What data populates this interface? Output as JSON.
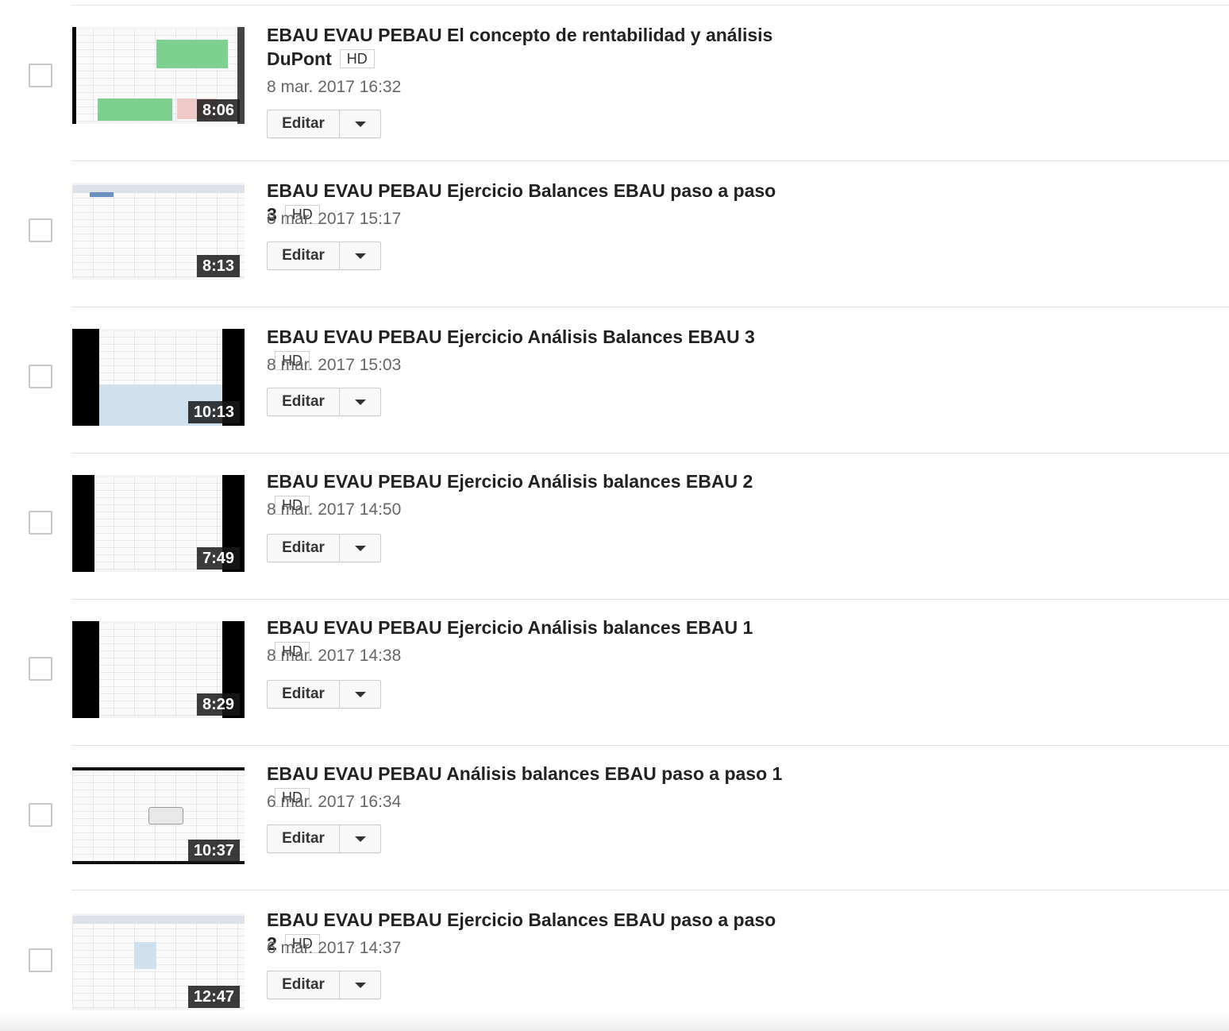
{
  "video_list": {
    "edit_label": "Editar",
    "hd_label": "HD",
    "videos": [
      {
        "title_line1": "EBAU EVAU PEBAU El concepto de rentabilidad y análisis",
        "title_line2": "DuPont",
        "date": "8 mar. 2017 16:32",
        "duration": "8:06"
      },
      {
        "title_line1": "EBAU EVAU PEBAU Ejercicio Balances EBAU paso a paso 3",
        "title_line2": "",
        "date": "8 mar. 2017 15:17",
        "duration": "8:13"
      },
      {
        "title_line1": "EBAU EVAU PEBAU Ejercicio Análisis Balances EBAU 3",
        "title_line2": "",
        "date": "8 mar. 2017 15:03",
        "duration": "10:13"
      },
      {
        "title_line1": "EBAU EVAU PEBAU Ejercicio Análisis balances EBAU 2",
        "title_line2": "",
        "date": "8 mar. 2017 14:50",
        "duration": "7:49"
      },
      {
        "title_line1": "EBAU EVAU PEBAU Ejercicio Análisis balances EBAU 1",
        "title_line2": "",
        "date": "8 mar. 2017 14:38",
        "duration": "8:29"
      },
      {
        "title_line1": "EBAU EVAU PEBAU Análisis balances EBAU paso a paso 1",
        "title_line2": "",
        "date": "6 mar. 2017 16:34",
        "duration": "10:37"
      },
      {
        "title_line1": "EBAU EVAU PEBAU Ejercicio Balances EBAU paso a paso 2",
        "title_line2": "",
        "date": "6 mar. 2017 14:37",
        "duration": "12:47"
      }
    ]
  }
}
